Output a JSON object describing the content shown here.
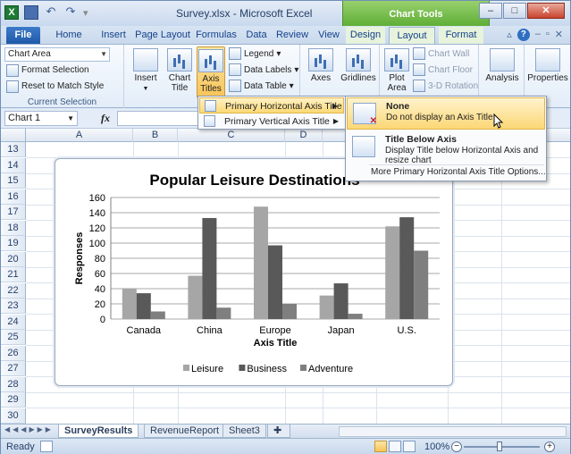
{
  "window": {
    "title": "Survey.xlsx - Microsoft Excel",
    "contextual_tab_group": "Chart Tools"
  },
  "tabs": [
    "File",
    "Home",
    "Insert",
    "Page Layout",
    "Formulas",
    "Data",
    "Review",
    "View",
    "Design",
    "Layout",
    "Format"
  ],
  "active_tab": "Layout",
  "ribbon": {
    "current_selection": {
      "dropdown_value": "Chart Area",
      "format_selection": "Format Selection",
      "reset_to_match_style": "Reset to Match Style",
      "group_label": "Current Selection"
    },
    "insert_label": "Insert",
    "chart_title_label": "Chart Title",
    "axis_titles_label": "Axis Titles",
    "legend_label": "Legend",
    "data_labels_label": "Data Labels",
    "data_table_label": "Data Table",
    "axes_label": "Axes",
    "gridlines_label": "Gridlines",
    "plot_area_label": "Plot Area",
    "chart_wall_label": "Chart Wall",
    "chart_floor_label": "Chart Floor",
    "rotation_label": "3-D Rotation",
    "analysis_label": "Analysis",
    "properties_label": "Properties"
  },
  "formula_bar": {
    "name_box": "Chart 1",
    "fx_label": "fx"
  },
  "axis_titles_menu": {
    "items": [
      {
        "label": "Primary Horizontal Axis Title"
      },
      {
        "label": "Primary Vertical Axis Title"
      }
    ]
  },
  "horizontal_title_submenu": {
    "options": [
      {
        "title": "None",
        "description": "Do not display an Axis Title"
      },
      {
        "title": "Title Below Axis",
        "description": "Display Title below Horizontal Axis and resize chart"
      }
    ],
    "more_options": "More Primary Horizontal Axis Title Options..."
  },
  "grid": {
    "columns": [
      "A",
      "B",
      "C",
      "D"
    ],
    "rows": [
      "13",
      "14",
      "15",
      "16",
      "17",
      "18",
      "19",
      "20",
      "21",
      "22",
      "23",
      "24",
      "25",
      "26",
      "27",
      "28",
      "29",
      "30"
    ]
  },
  "chart_data": {
    "type": "bar",
    "title": "Popular Leisure Destinations",
    "xlabel": "Axis Title",
    "ylabel": "Responses",
    "ylim": [
      0,
      160
    ],
    "yticks": [
      0,
      20,
      40,
      60,
      80,
      100,
      120,
      140,
      160
    ],
    "categories": [
      "Canada",
      "China",
      "Europe",
      "Japan",
      "U.S."
    ],
    "series": [
      {
        "name": "Leisure",
        "color": "#a6a6a6",
        "values": [
          40,
          57,
          148,
          31,
          122
        ]
      },
      {
        "name": "Business",
        "color": "#595959",
        "values": [
          34,
          133,
          97,
          47,
          134
        ]
      },
      {
        "name": "Adventure",
        "color": "#7f7f7f",
        "values": [
          10,
          15,
          20,
          7,
          90
        ]
      }
    ],
    "legend_position": "bottom",
    "grid": true
  },
  "sheet_tabs": [
    "SurveyResults",
    "RevenueReport",
    "Sheet3"
  ],
  "active_sheet": "SurveyResults",
  "status": {
    "ready": "Ready",
    "zoom": "100%"
  }
}
